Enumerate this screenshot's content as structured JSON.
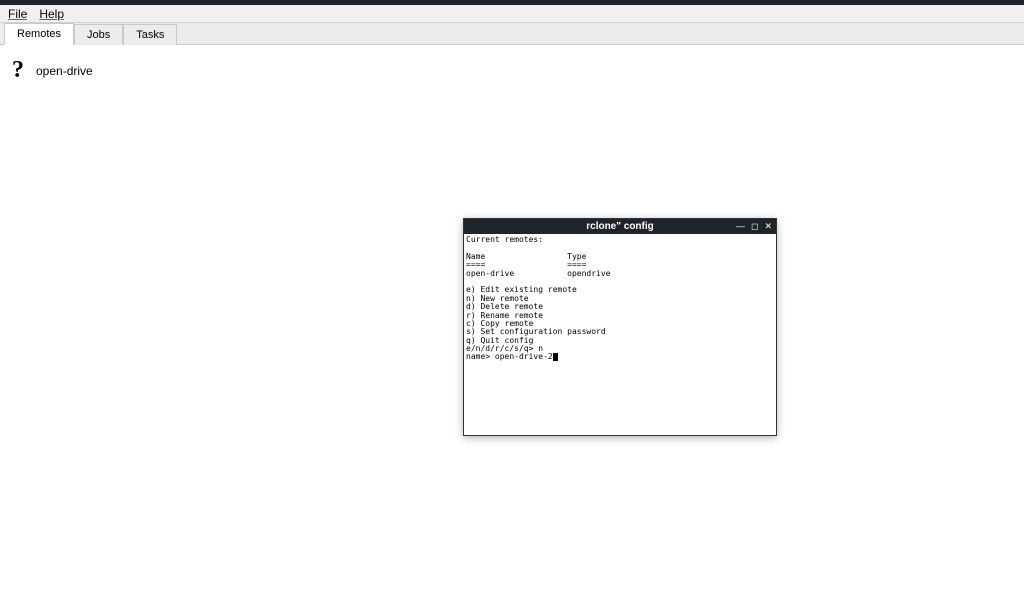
{
  "menubar": {
    "file": "File",
    "help": "Help"
  },
  "tabs": {
    "remotes": "Remotes",
    "jobs": "Jobs",
    "tasks": "Tasks"
  },
  "remote": {
    "label": "open-drive"
  },
  "terminal": {
    "title": "rclone\" config",
    "line_current": "Current remotes:",
    "line_blank": "",
    "hdr_row": "Name                 Type",
    "hdr_rule": "====                 ====",
    "row1": "open-drive           opendrive",
    "opt_e": "e) Edit existing remote",
    "opt_n": "n) New remote",
    "opt_d": "d) Delete remote",
    "opt_r": "r) Rename remote",
    "opt_c": "c) Copy remote",
    "opt_s": "s) Set configuration password",
    "opt_q": "q) Quit config",
    "prompt1": "e/n/d/r/c/s/q> n",
    "prompt2": "name> open-drive-2"
  }
}
